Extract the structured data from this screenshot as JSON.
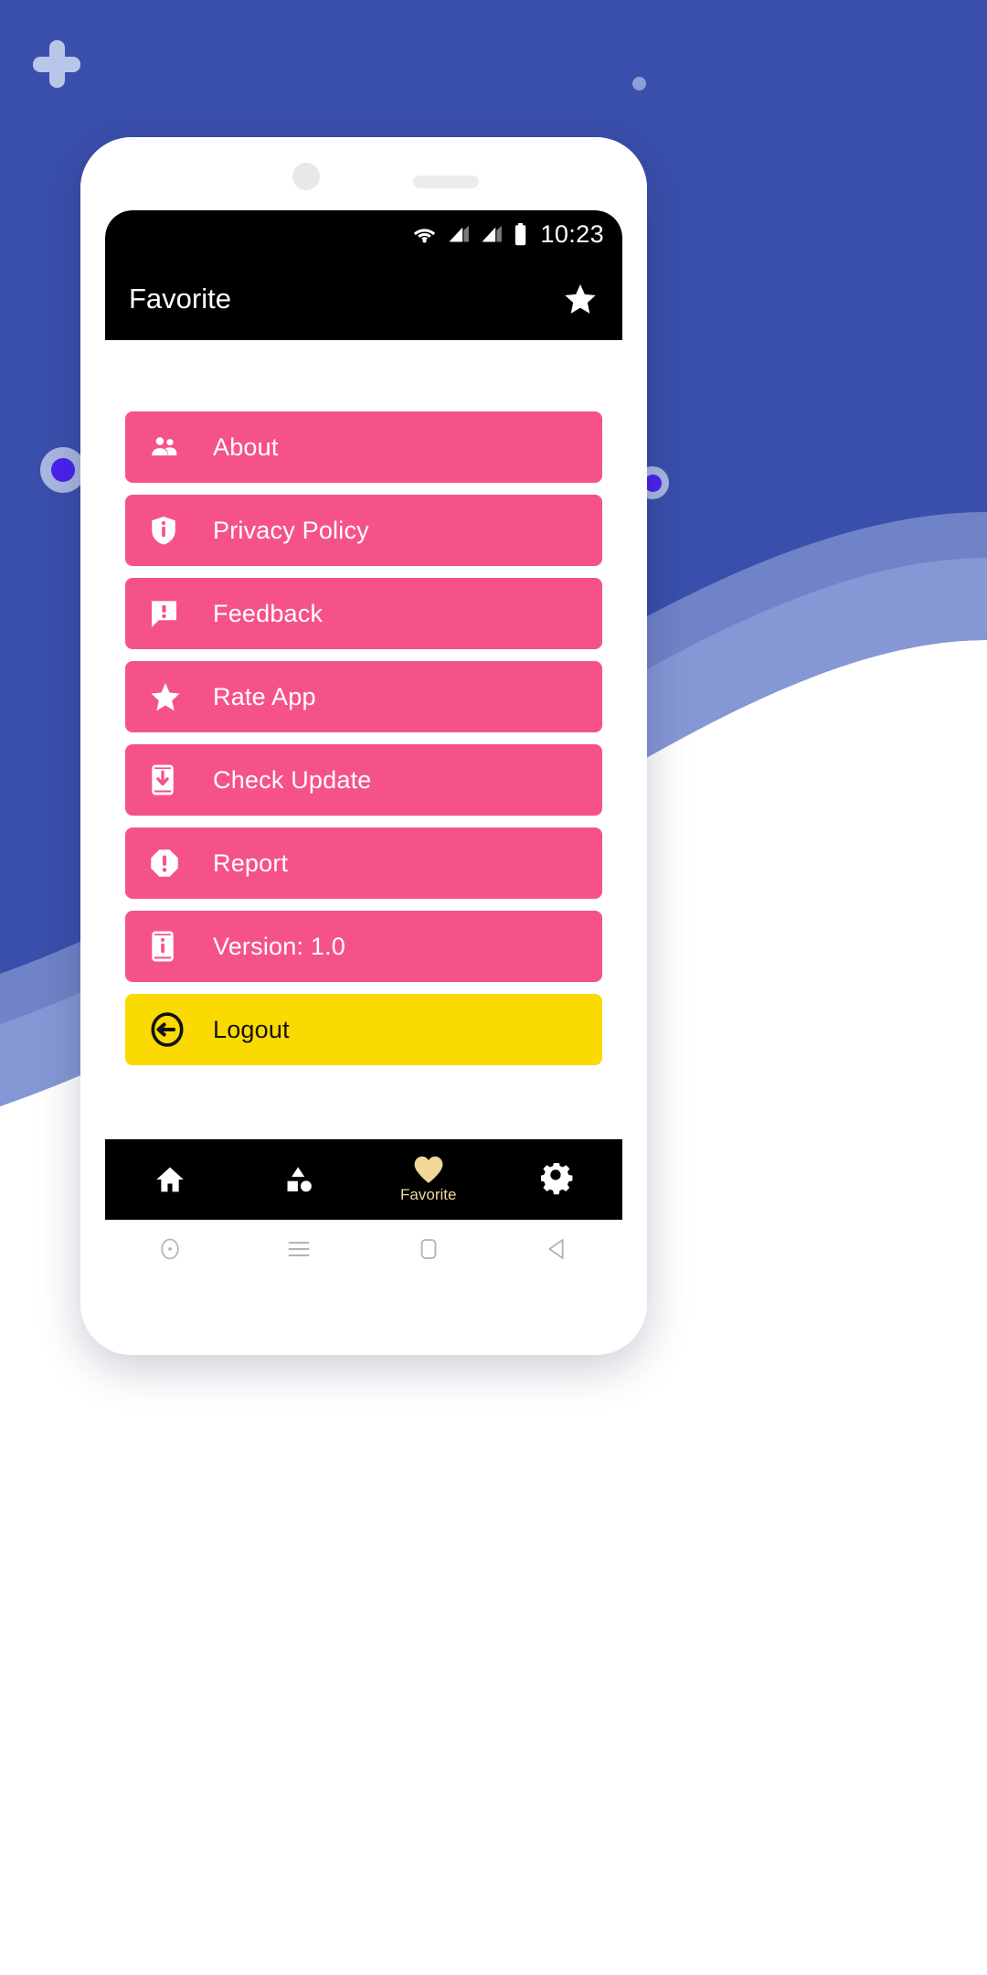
{
  "background": {
    "color": "#3a4fab",
    "band_mid_color": "#8c9dd8",
    "decorations": [
      {
        "name": "plus-decoration",
        "icon": "plus-icon",
        "color": "#b9c6ea"
      },
      {
        "name": "ring-decoration",
        "icon": "circle-ring-icon",
        "ring_color": "#a9b7e2",
        "center_color": "#4b22ec"
      },
      {
        "name": "dot-decoration-top-right",
        "icon": "dot-icon",
        "color": "#8e9ed6"
      },
      {
        "name": "ring-decoration-right",
        "icon": "circle-ring-icon",
        "ring_color": "#a9b7e2",
        "center_color": "#4b22ec"
      }
    ]
  },
  "statusbar": {
    "time": "10:23",
    "icons": [
      "wifi-icon",
      "signal-icon",
      "signal-icon",
      "battery-icon"
    ]
  },
  "appbar": {
    "title": "Favorite",
    "action_icon": "star-icon",
    "background": "#000000",
    "text_color": "#ffffff"
  },
  "menu": {
    "items": [
      {
        "label": "About",
        "icon": "people-icon",
        "style": "pink",
        "bg": "#f5528c"
      },
      {
        "label": "Privacy Policy",
        "icon": "shield-info-icon",
        "style": "pink",
        "bg": "#f5528c"
      },
      {
        "label": "Feedback",
        "icon": "feedback-chat-icon",
        "style": "pink",
        "bg": "#f5528c"
      },
      {
        "label": "Rate App",
        "icon": "star-icon",
        "style": "pink",
        "bg": "#f5528c"
      },
      {
        "label": "Check Update",
        "icon": "phone-download-icon",
        "style": "pink",
        "bg": "#f5528c"
      },
      {
        "label": "Report",
        "icon": "octagon-alert-icon",
        "style": "pink",
        "bg": "#f5528c"
      },
      {
        "label": "Version: 1.0",
        "icon": "phone-info-icon",
        "style": "pink",
        "bg": "#f5528c"
      },
      {
        "label": "Logout",
        "icon": "logout-arrow-icon",
        "style": "yellow",
        "bg": "#fada00"
      }
    ]
  },
  "bottom_nav": {
    "background": "#000000",
    "active_color": "#f0d898",
    "items": [
      {
        "label": "",
        "icon": "home-icon",
        "active": false
      },
      {
        "label": "",
        "icon": "category-icon",
        "active": false
      },
      {
        "label": "Favorite",
        "icon": "heart-icon",
        "active": true
      },
      {
        "label": "",
        "icon": "gear-icon",
        "active": false
      }
    ]
  },
  "system_nav": {
    "items": [
      "assistant-circle-icon",
      "menu-hamburger-icon",
      "home-square-icon",
      "back-triangle-icon"
    ],
    "color": "#b0b0b0"
  }
}
